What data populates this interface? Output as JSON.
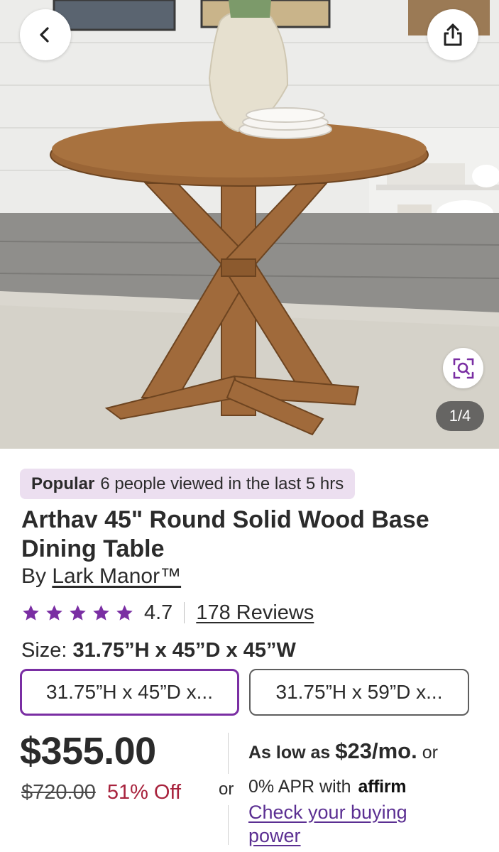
{
  "gallery": {
    "counter": "1/4",
    "back_icon": "chevron-left-icon",
    "share_icon": "share-icon",
    "zoom_icon": "visual-search-icon"
  },
  "popular": {
    "label": "Popular",
    "text": "6 people viewed in the last 5 hrs"
  },
  "product": {
    "title": "Arthav 45\" Round Solid Wood Base Dining Table",
    "by": "By",
    "brand": "Lark Manor™",
    "rating": "4.7",
    "stars": 5,
    "reviews": "178 Reviews"
  },
  "size": {
    "label": "Size:",
    "selected": "31.75”H x 45”D x 45”W",
    "options": [
      "31.75”H x 45”D x...",
      "31.75”H x 59”D x..."
    ]
  },
  "pricing": {
    "price": "$355.00",
    "was": "$720.00",
    "off": "51% Off",
    "or": "or",
    "as_low_as": "As low as",
    "monthly": "$23/mo.",
    "or_after": "or",
    "apr": "0% APR with",
    "affirm": "affirm",
    "check_link": "Check your buying power"
  },
  "colors": {
    "accent": "#7a2ea3",
    "popular_bg": "#ecdff0",
    "discount": "#a8233d",
    "link": "#5b2f92"
  }
}
